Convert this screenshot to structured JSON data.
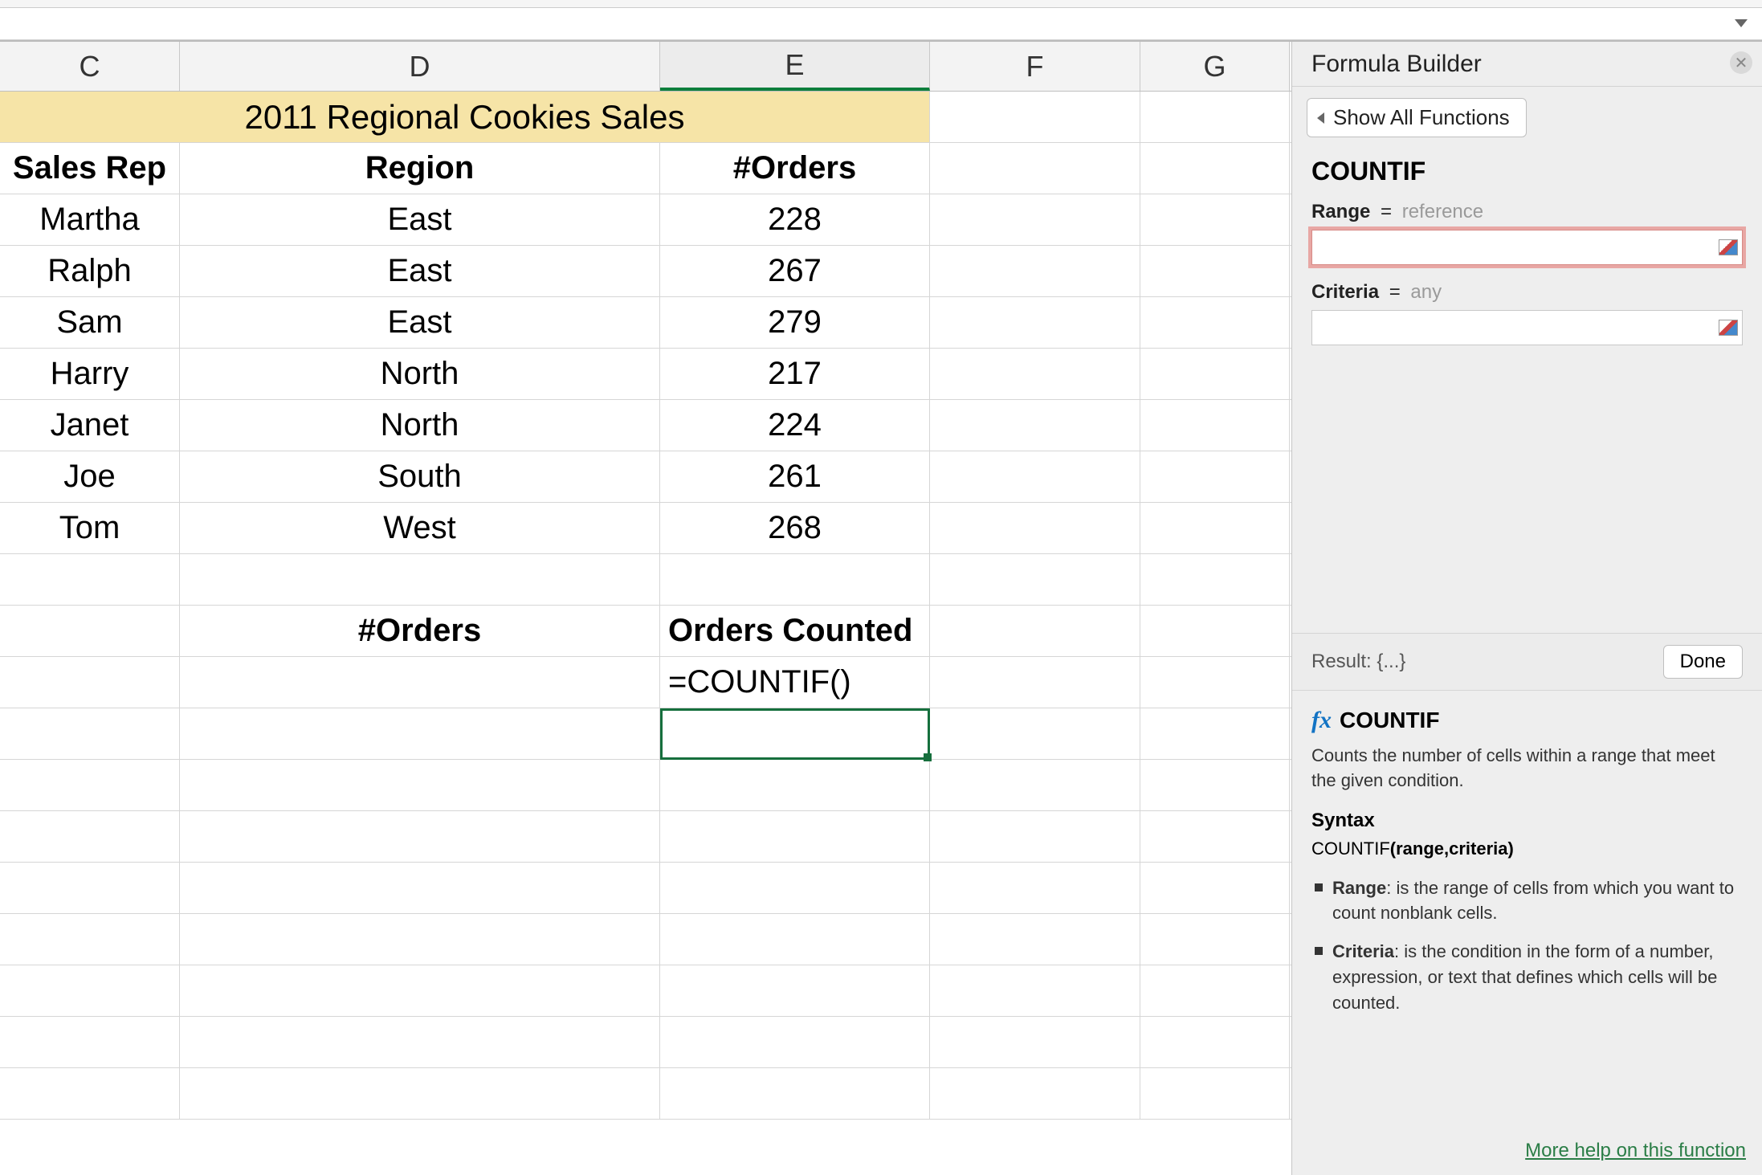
{
  "columns": {
    "C": "C",
    "D": "D",
    "E": "E",
    "F": "F",
    "G": "G"
  },
  "sheet": {
    "title": "2011 Regional Cookies Sales",
    "headers": {
      "salesRep": "Sales Rep",
      "region": "Region",
      "orders": "#Orders"
    },
    "rows": [
      {
        "rep": "Martha",
        "region": "East",
        "orders": "228"
      },
      {
        "rep": "Ralph",
        "region": "East",
        "orders": "267"
      },
      {
        "rep": "Sam",
        "region": "East",
        "orders": "279"
      },
      {
        "rep": "Harry",
        "region": "North",
        "orders": "217"
      },
      {
        "rep": "Janet",
        "region": "North",
        "orders": "224"
      },
      {
        "rep": "Joe",
        "region": "South",
        "orders": "261"
      },
      {
        "rep": "Tom",
        "region": "West",
        "orders": "268"
      }
    ],
    "summary": {
      "dLabel": "#Orders",
      "eLabel": "Orders Counted",
      "formula": "=COUNTIF()"
    }
  },
  "panel": {
    "title": "Formula Builder",
    "showAll": "Show All Functions",
    "functionName": "COUNTIF",
    "args": {
      "range": {
        "label": "Range",
        "eq": "=",
        "hint": "reference",
        "value": ""
      },
      "criteria": {
        "label": "Criteria",
        "eq": "=",
        "hint": "any",
        "value": ""
      }
    },
    "resultLabel": "Result: {...}",
    "done": "Done",
    "fxName": "COUNTIF",
    "description": "Counts the number of cells within a range that meet the given condition.",
    "syntaxHeading": "Syntax",
    "syntaxValue": "COUNTIF(range,criteria)",
    "syntaxBoldPart": "(range,criteria)",
    "bullets": {
      "rangeBold": "Range",
      "rangeRest": ": is the range of cells from which you want to count nonblank cells.",
      "criteriaBold": "Criteria",
      "criteriaRest": ": is the condition in the form of a number, expression, or text that defines which cells will be counted."
    },
    "moreHelp": "More help on this function"
  }
}
